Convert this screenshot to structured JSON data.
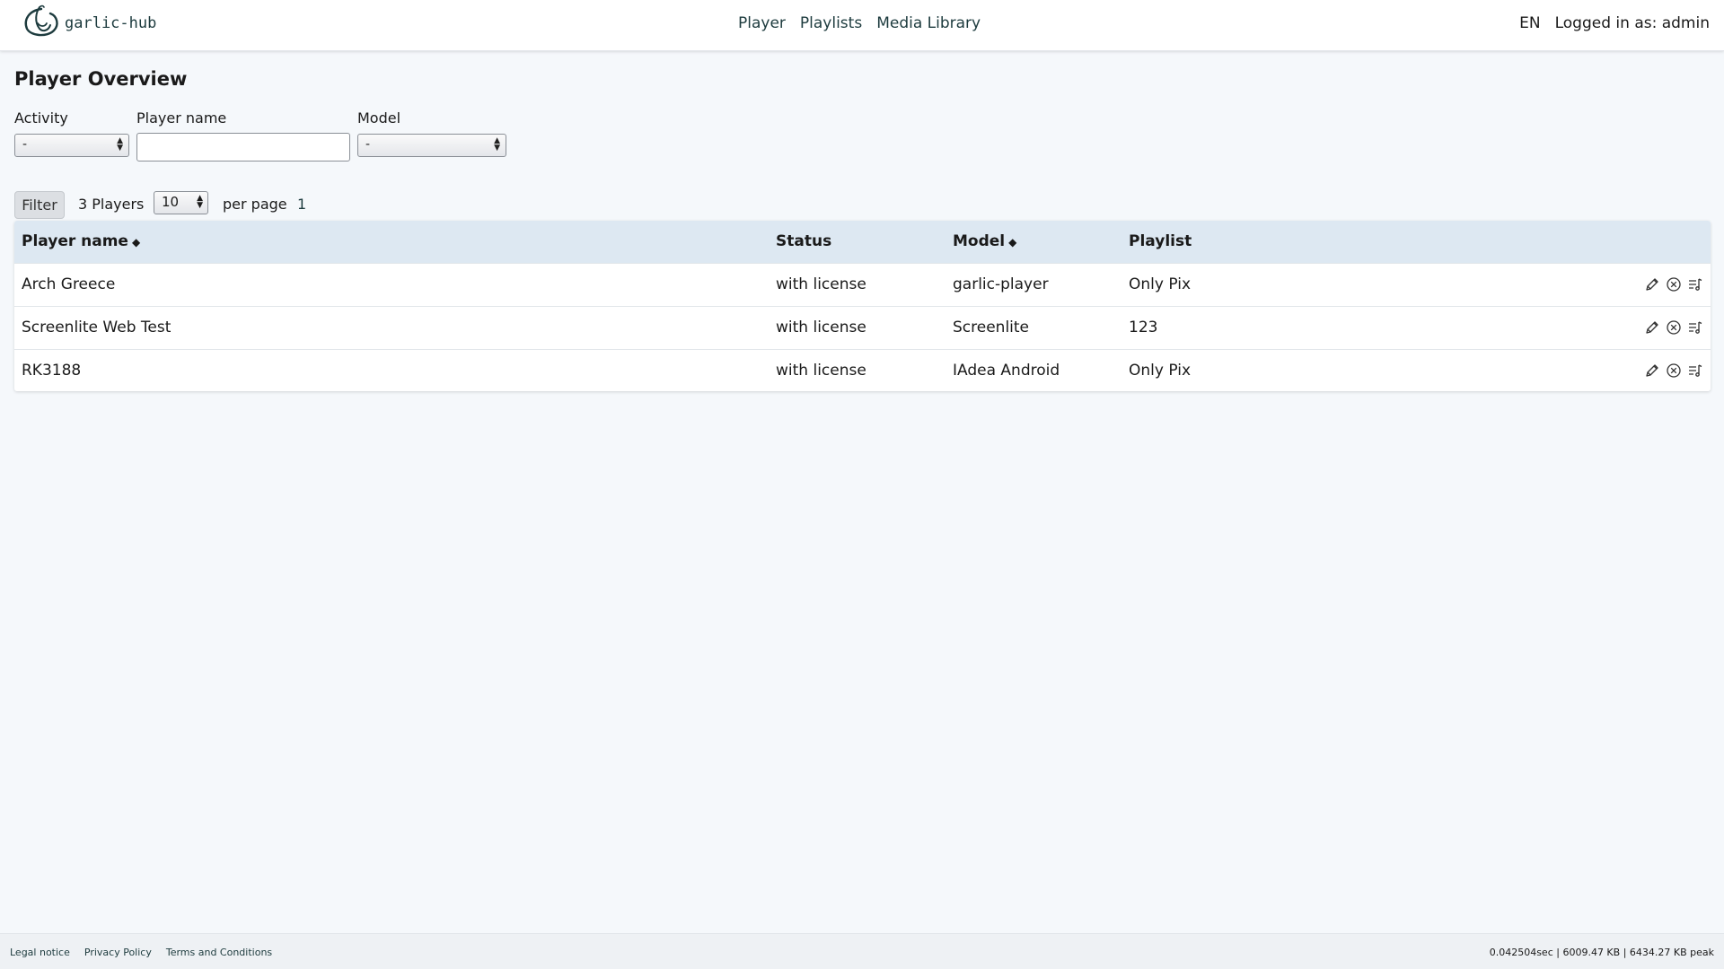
{
  "header": {
    "logo_text": "garlic-hub",
    "nav": [
      "Player",
      "Playlists",
      "Media Library"
    ],
    "language": "EN",
    "user_status": "Logged in as: admin"
  },
  "page": {
    "title": "Player Overview"
  },
  "filters": {
    "activity_label": "Activity",
    "activity_value": "-",
    "player_name_label": "Player name",
    "player_name_value": "",
    "model_label": "Model",
    "model_value": "-"
  },
  "listing": {
    "filter_button": "Filter",
    "count_text": "3 Players",
    "per_page_value": "10",
    "per_page_label": "per page",
    "current_page": "1"
  },
  "table": {
    "headers": {
      "player_name": "Player name",
      "status": "Status",
      "model": "Model",
      "playlist": "Playlist"
    },
    "sort_marker": "◆",
    "rows": [
      {
        "player_name": "Arch Greece",
        "status": "with license",
        "model": "garlic-player",
        "playlist": "Only Pix"
      },
      {
        "player_name": "Screenlite Web Test",
        "status": "with license",
        "model": "Screenlite",
        "playlist": "123"
      },
      {
        "player_name": "RK3188",
        "status": "with license",
        "model": "IAdea Android",
        "playlist": "Only Pix"
      }
    ],
    "row_actions": [
      "edit-icon",
      "remove-icon",
      "playlist-assign-icon"
    ]
  },
  "footer": {
    "links": [
      "Legal notice",
      "Privacy Policy",
      "Terms and Conditions"
    ],
    "stats": "0.042504sec | 6009.47 KB | 6434.27 KB peak"
  },
  "colors": {
    "background": "#f5f8fb",
    "header_bg": "#ffffff",
    "table_header_bg": "#dde8f2",
    "link": "#1d3b3e",
    "text": "#1a1a1a"
  }
}
